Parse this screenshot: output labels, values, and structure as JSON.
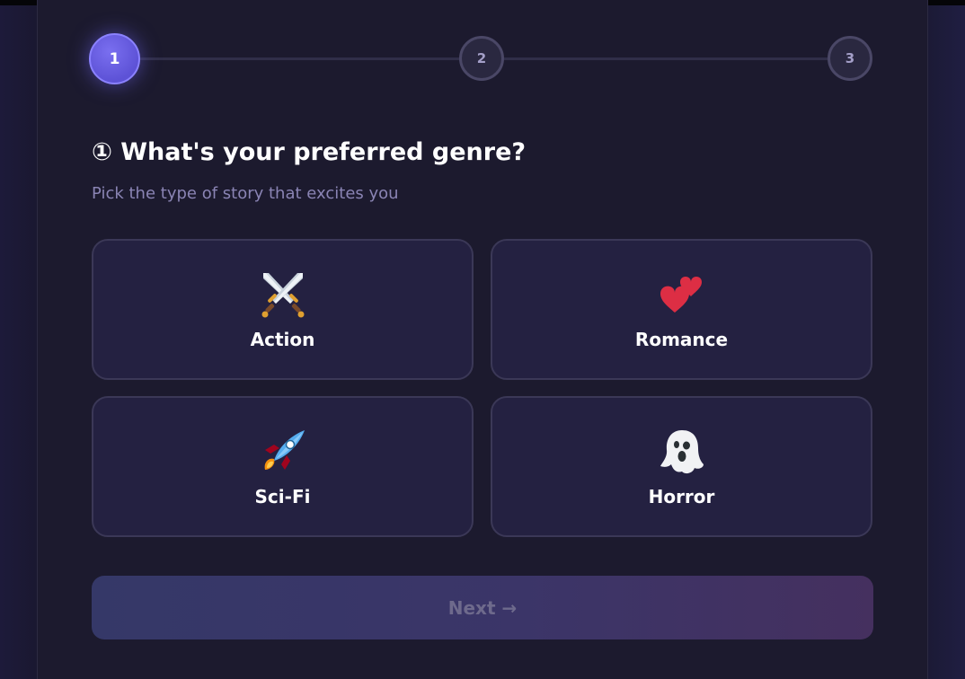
{
  "stepper": {
    "steps": [
      "1",
      "2",
      "3"
    ],
    "active_index": 0
  },
  "question": {
    "title": "① What's your preferred genre?",
    "subtitle": "Pick the type of story that excites you"
  },
  "options": [
    {
      "label": "Action",
      "icon": "crossed-swords-icon"
    },
    {
      "label": "Romance",
      "icon": "two-hearts-icon"
    },
    {
      "label": "Sci-Fi",
      "icon": "rocket-icon"
    },
    {
      "label": "Horror",
      "icon": "ghost-icon"
    }
  ],
  "next_button": {
    "label": "Next →",
    "enabled": false
  },
  "colors": {
    "accent": "#6c63e6",
    "card_bg": "#1c1a2e",
    "option_bg": "#242141",
    "option_border": "#3b3857",
    "subtitle": "#8a84b4"
  }
}
